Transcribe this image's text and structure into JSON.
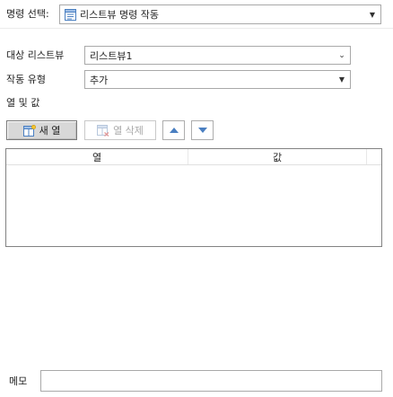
{
  "command_select": {
    "label": "명령 선택:",
    "value": "리스트뷰 명령 작동",
    "icon": "listview-command-icon"
  },
  "target_listview": {
    "label": "대상 리스트뷰",
    "value": "리스트뷰1"
  },
  "action_type": {
    "label": "작동 유형",
    "value": "추가"
  },
  "columns_and_values": {
    "label": "열 및 값"
  },
  "toolbar": {
    "new_column_label": "새 열",
    "delete_column_label": "열 삭제",
    "move_up_icon": "triangle-up-icon",
    "move_down_icon": "triangle-down-icon"
  },
  "grid": {
    "columns": [
      "열",
      "값"
    ],
    "rows": []
  },
  "memo": {
    "label": "메모",
    "value": ""
  },
  "colors": {
    "accent_blue": "#4a7fc1",
    "border": "#a9a9a9",
    "pressed_bg": "#d8d8d8"
  }
}
